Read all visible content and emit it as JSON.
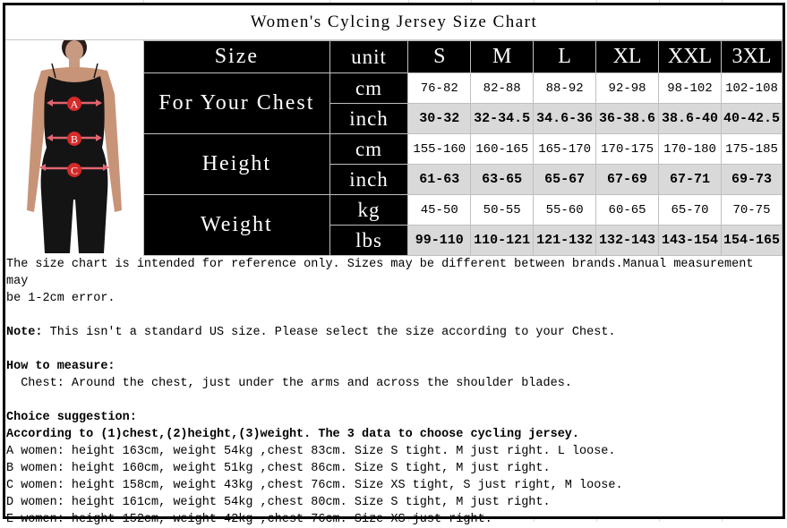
{
  "title": "Women's Cylcing Jersey Size Chart",
  "figure": {
    "markers": [
      "A",
      "B",
      "C"
    ],
    "accent_color": "#d42a2a"
  },
  "table": {
    "header": {
      "label": "Size",
      "unit": "unit",
      "sizes": [
        "S",
        "M",
        "L",
        "XL",
        "XXL",
        "3XL"
      ]
    },
    "groups": [
      {
        "label": "For Your Chest",
        "rows": [
          {
            "unit": "cm",
            "values": [
              "76-82",
              "82-88",
              "88-92",
              "92-98",
              "98-102",
              "102-108"
            ]
          },
          {
            "unit": "inch",
            "values": [
              "30-32",
              "32-34.5",
              "34.6-36",
              "36-38.6",
              "38.6-40",
              "40-42.5"
            ]
          }
        ]
      },
      {
        "label": "Height",
        "rows": [
          {
            "unit": "cm",
            "values": [
              "155-160",
              "160-165",
              "165-170",
              "170-175",
              "170-180",
              "175-185"
            ]
          },
          {
            "unit": "inch",
            "values": [
              "61-63",
              "63-65",
              "65-67",
              "67-69",
              "67-71",
              "69-73"
            ]
          }
        ]
      },
      {
        "label": "Weight",
        "rows": [
          {
            "unit": "kg",
            "values": [
              "45-50",
              "50-55",
              "55-60",
              "60-65",
              "65-70",
              "70-75"
            ]
          },
          {
            "unit": "lbs",
            "values": [
              "99-110",
              "110-121",
              "121-132",
              "132-143",
              "143-154",
              "154-165"
            ]
          }
        ]
      }
    ]
  },
  "notes": {
    "disclaimer_line1": "The size chart is intended for reference only. Sizes may be different between brands.Manual measurement may",
    "disclaimer_line2": "be 1-2cm error.",
    "note_label": "Note:",
    "note_text": " This isn't a standard US size. Please select the size according to your Chest.",
    "how_to_measure_heading": "How to measure:",
    "how_to_measure_text": "  Chest: Around the chest, just under the arms and across the shoulder blades.",
    "choice_heading": "Choice suggestion:",
    "choice_subheading": "According to (1)chest,(2)height,(3)weight. The 3 data to choose cycling jersey.",
    "examples": [
      "A women: height 163cm, weight 54kg ,chest 83cm. Size S tight. M just right. L loose.",
      "B women: height 160cm, weight 51kg ,chest 86cm. Size S tight, M just right.",
      "C women: height 158cm, weight 43kg ,chest 76cm. Size XS tight, S just right, M loose.",
      "D women: height 161cm, weight 54kg ,chest 80cm. Size S tight, M just right.",
      "E women: height 152cm, weight 42kg ,chest 76cm. Size XS just right."
    ]
  }
}
